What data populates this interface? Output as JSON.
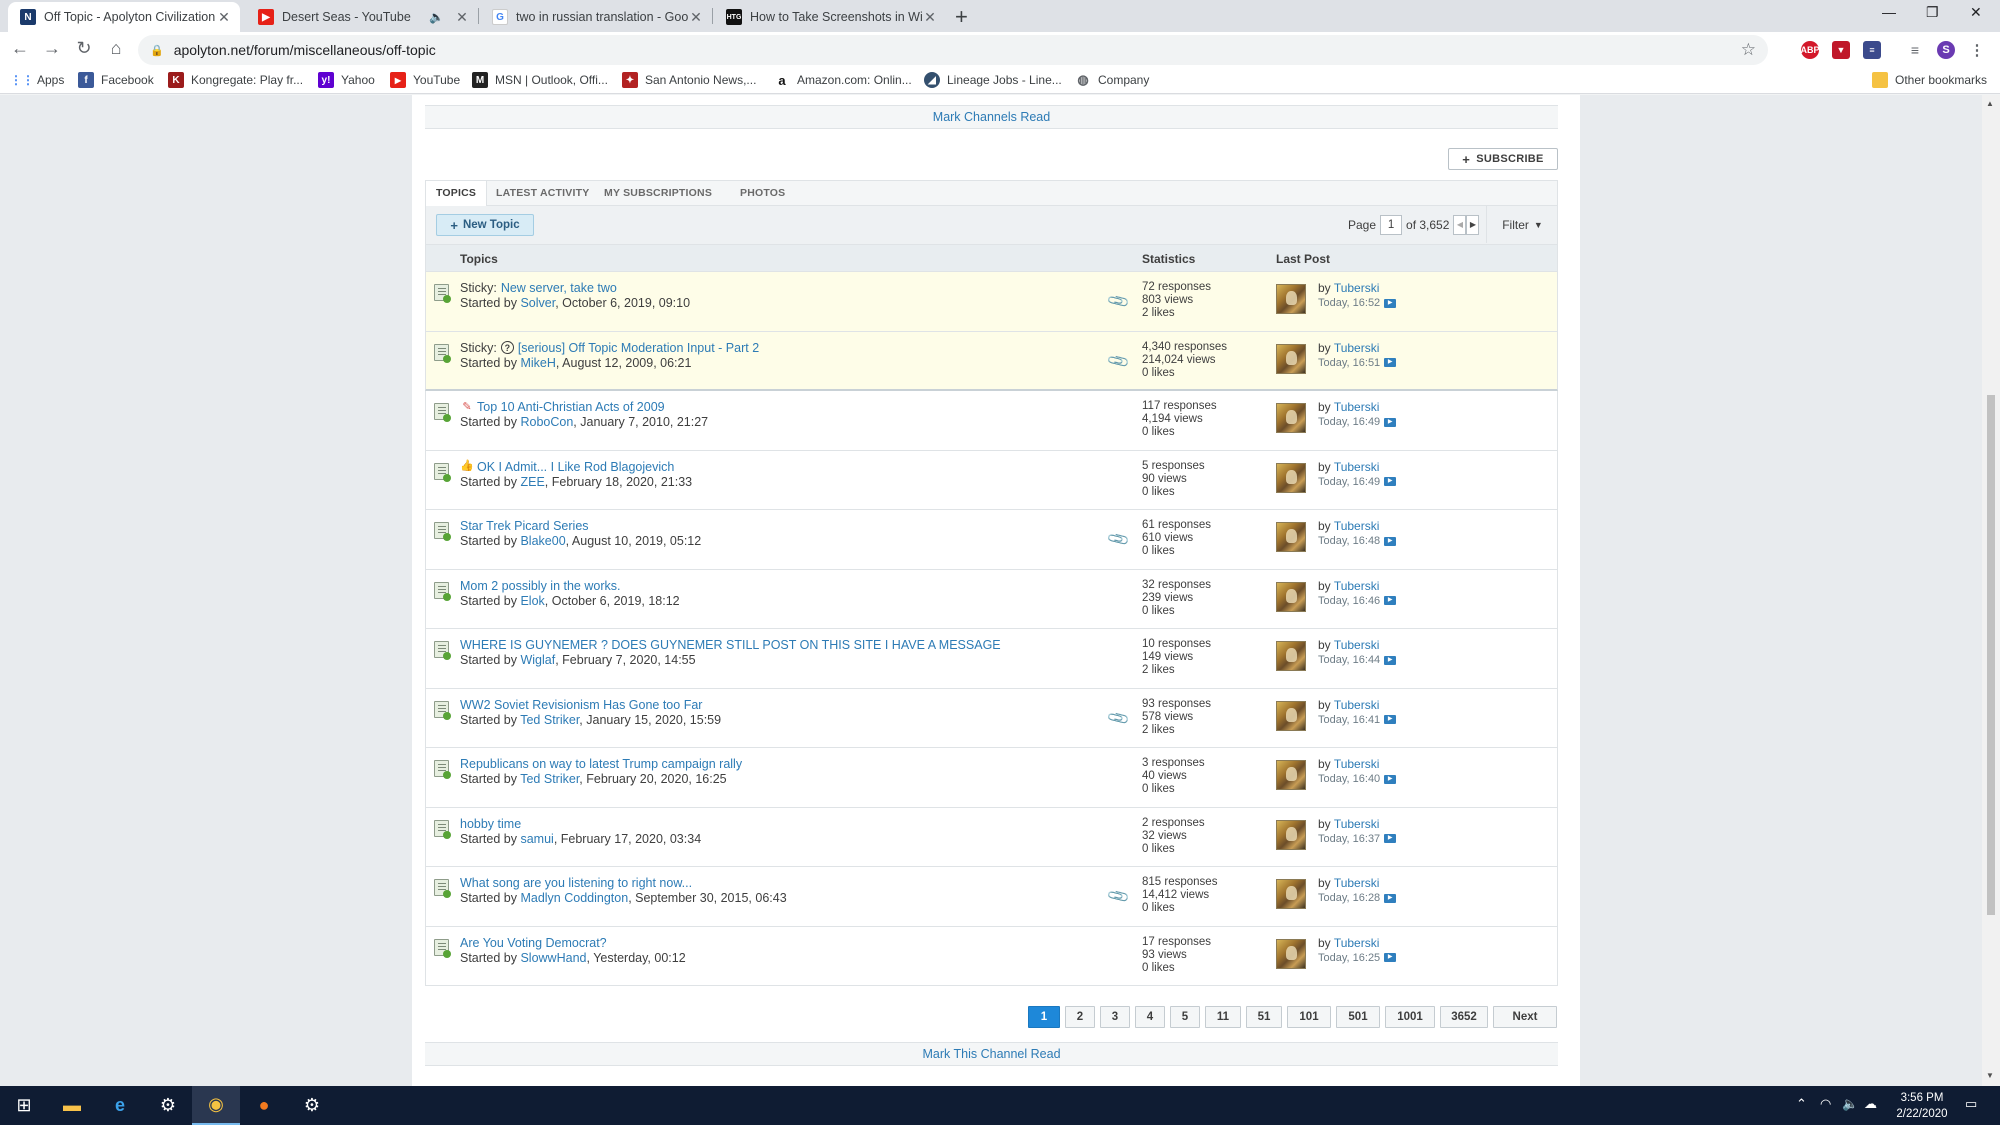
{
  "browser": {
    "tabs": [
      {
        "title": "Off Topic - Apolyton Civilization S",
        "favicon": "apolyton-icon",
        "active": true
      },
      {
        "title": "Desert Seas - YouTube",
        "favicon": "youtube-icon",
        "audio": true
      },
      {
        "title": "two in russian translation - Goog",
        "favicon": "google-icon"
      },
      {
        "title": "How to Take Screenshots in Wind",
        "favicon": "htg-icon"
      }
    ],
    "url": "apolyton.net/forum/miscellaneous/off-topic",
    "profile_initial": "S",
    "bookmarks": [
      {
        "label": "Apps",
        "icon": "apps-grid-icon"
      },
      {
        "label": "Facebook",
        "icon": "facebook-icon"
      },
      {
        "label": "Kongregate: Play fr...",
        "icon": "kongregate-icon"
      },
      {
        "label": "Yahoo",
        "icon": "yahoo-icon"
      },
      {
        "label": "YouTube",
        "icon": "youtube-icon"
      },
      {
        "label": "MSN | Outlook, Offi...",
        "icon": "msn-icon"
      },
      {
        "label": "San Antonio News,...",
        "icon": "news-icon"
      },
      {
        "label": "Amazon.com: Onlin...",
        "icon": "amazon-icon"
      },
      {
        "label": "Lineage Jobs - Line...",
        "icon": "lineage-icon"
      },
      {
        "label": "Company",
        "icon": "globe-icon"
      }
    ],
    "other_bookmarks": "Other bookmarks"
  },
  "forum": {
    "mark_channels_read": "Mark Channels Read",
    "subscribe_label": "SUBSCRIBE",
    "tabs": [
      "TOPICS",
      "LATEST ACTIVITY",
      "MY SUBSCRIPTIONS",
      "PHOTOS"
    ],
    "new_topic_label": "New Topic",
    "page_label": "Page",
    "current_page": "1",
    "of_pages": "of 3,652",
    "filter_label": "Filter",
    "columns": {
      "topics": "Topics",
      "statistics": "Statistics",
      "last_post": "Last Post"
    },
    "topics": [
      {
        "prefix": "Sticky:",
        "title": "New server, take two",
        "author": "Solver",
        "date": "October 6, 2019, 09:10",
        "responses": "72 responses",
        "views": "803 views",
        "likes": "2 likes",
        "lp_by": "by",
        "lp_user": "Tuberski",
        "lp_time": "Today, 16:52",
        "attachment": true
      },
      {
        "prefix": "Sticky:",
        "title": "[serious] Off Topic Moderation Input - Part 2",
        "author": "MikeH",
        "date": "August 12, 2009, 06:21",
        "responses": "4,340 responses",
        "views": "214,024 views",
        "likes": "0 likes",
        "lp_by": "by",
        "lp_user": "Tuberski",
        "lp_time": "Today, 16:51",
        "attachment": true
      },
      {
        "prefix": "",
        "title": "Top 10 Anti-Christian Acts of 2009",
        "author": "RoboCon",
        "date": "January 7, 2010, 21:27",
        "responses": "117 responses",
        "views": "4,194 views",
        "likes": "0 likes",
        "lp_by": "by",
        "lp_user": "Tuberski",
        "lp_time": "Today, 16:49",
        "attachment": false
      },
      {
        "prefix": "",
        "title": "OK I Admit... I Like Rod Blagojevich",
        "author": "ZEE",
        "date": "February 18, 2020, 21:33",
        "responses": "5 responses",
        "views": "90 views",
        "likes": "0 likes",
        "lp_by": "by",
        "lp_user": "Tuberski",
        "lp_time": "Today, 16:49",
        "attachment": false
      },
      {
        "prefix": "",
        "title": "Star Trek Picard Series",
        "author": "Blake00",
        "date": "August 10, 2019, 05:12",
        "responses": "61 responses",
        "views": "610 views",
        "likes": "0 likes",
        "lp_by": "by",
        "lp_user": "Tuberski",
        "lp_time": "Today, 16:48",
        "attachment": true
      },
      {
        "prefix": "",
        "title": "Mom 2 possibly in the works.",
        "author": "Elok",
        "date": "October 6, 2019, 18:12",
        "responses": "32 responses",
        "views": "239 views",
        "likes": "0 likes",
        "lp_by": "by",
        "lp_user": "Tuberski",
        "lp_time": "Today, 16:46",
        "attachment": false
      },
      {
        "prefix": "",
        "title": "WHERE IS GUYNEMER ? DOES GUYNEMER STILL POST ON THIS SITE I HAVE A MESSAGE",
        "author": "Wiglaf",
        "date": "February 7, 2020, 14:55",
        "responses": "10 responses",
        "views": "149 views",
        "likes": "2 likes",
        "lp_by": "by",
        "lp_user": "Tuberski",
        "lp_time": "Today, 16:44",
        "attachment": false
      },
      {
        "prefix": "",
        "title": "WW2 Soviet Revisionism Has Gone too Far",
        "author": "Ted Striker",
        "date": "January 15, 2020, 15:59",
        "responses": "93 responses",
        "views": "578 views",
        "likes": "2 likes",
        "lp_by": "by",
        "lp_user": "Tuberski",
        "lp_time": "Today, 16:41",
        "attachment": true
      },
      {
        "prefix": "",
        "title": "Republicans on way to latest Trump campaign rally",
        "author": "Ted Striker",
        "date": "February 20, 2020, 16:25",
        "responses": "3 responses",
        "views": "40 views",
        "likes": "0 likes",
        "lp_by": "by",
        "lp_user": "Tuberski",
        "lp_time": "Today, 16:40",
        "attachment": false
      },
      {
        "prefix": "",
        "title": "hobby time",
        "author": "samui",
        "date": "February 17, 2020, 03:34",
        "responses": "2 responses",
        "views": "32 views",
        "likes": "0 likes",
        "lp_by": "by",
        "lp_user": "Tuberski",
        "lp_time": "Today, 16:37",
        "attachment": false
      },
      {
        "prefix": "",
        "title": "What song are you listening to right now...",
        "author": "Madlyn Coddington",
        "date": "September 30, 2015, 06:43",
        "responses": "815 responses",
        "views": "14,412 views",
        "likes": "0 likes",
        "lp_by": "by",
        "lp_user": "Tuberski",
        "lp_time": "Today, 16:28",
        "attachment": true
      },
      {
        "prefix": "",
        "title": "Are You Voting Democrat?",
        "author": "SlowwHand",
        "date": "Yesterday, 00:12",
        "responses": "17 responses",
        "views": "93 views",
        "likes": "0 likes",
        "lp_by": "by",
        "lp_user": "Tuberski",
        "lp_time": "Today, 16:25",
        "attachment": false
      }
    ],
    "started_by": "Started by",
    "pages": [
      "1",
      "2",
      "3",
      "4",
      "5",
      "11",
      "51",
      "101",
      "501",
      "1001",
      "3652"
    ],
    "next_label": "Next",
    "mark_channel_read": "Mark This Channel Read"
  },
  "taskbar": {
    "time": "3:56 PM",
    "date": "2/22/2020"
  },
  "colors": {
    "link": "#2d7bb5",
    "sticky_bg": "#fefde8",
    "current_page": "#1e88d9",
    "taskbar": "#0f1c33"
  }
}
